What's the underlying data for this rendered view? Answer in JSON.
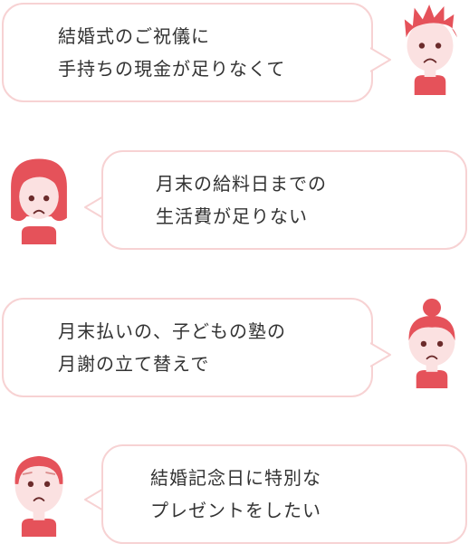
{
  "colors": {
    "accent": "#e5525a",
    "skin": "#fbe1e1",
    "bubble_border": "#f7d2d3",
    "text": "#333333"
  },
  "items": [
    {
      "lines": [
        "結婚式のご祝儀に",
        "手持ちの現金が足りなくて"
      ],
      "avatar": "spiky-hair-man-avatar",
      "side": "right"
    },
    {
      "lines": [
        "月末の給料日までの",
        "生活費が足りない"
      ],
      "avatar": "bob-hair-woman-avatar",
      "side": "left"
    },
    {
      "lines": [
        "月末払いの、子どもの塾の",
        "月謝の立て替えで"
      ],
      "avatar": "bun-hair-woman-avatar",
      "side": "right"
    },
    {
      "lines": [
        "結婚記念日に特別な",
        "プレゼントをしたい"
      ],
      "avatar": "older-man-avatar",
      "side": "left"
    }
  ]
}
